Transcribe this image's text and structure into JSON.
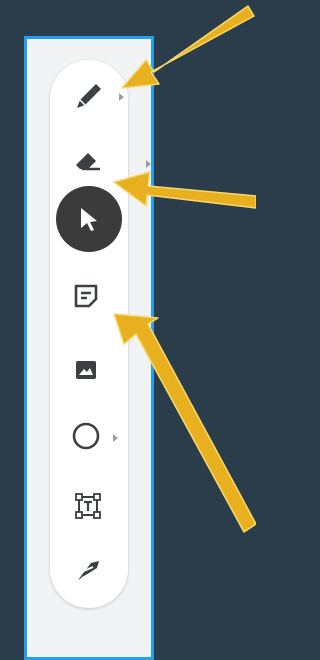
{
  "colors": {
    "background": "#2b3d4a",
    "panel_border": "#21a0ee",
    "tool_icon": "#3c4043",
    "selected_tool_bg": "#3b3b3b",
    "arrow_fill": "#e8b01f",
    "arrow_stroke": "#f6d96c"
  },
  "toolbar": {
    "tools": [
      {
        "icon": "pen-icon",
        "has_submenu": true
      },
      {
        "icon": "eraser-icon",
        "has_submenu": true
      },
      {
        "icon": "select-cursor-icon",
        "selected": true
      },
      {
        "icon": "sticky-note-icon"
      },
      {
        "icon": "image-icon"
      },
      {
        "icon": "circle-shape-icon",
        "has_submenu": true
      },
      {
        "icon": "text-box-icon"
      },
      {
        "icon": "laser-pointer-icon"
      }
    ]
  },
  "annotations": [
    {
      "name": "callout-arrow",
      "points_to": "pen-icon"
    },
    {
      "name": "callout-arrow",
      "points_to": "eraser-icon"
    },
    {
      "name": "callout-arrow",
      "points_to": "sticky-note-icon"
    }
  ]
}
